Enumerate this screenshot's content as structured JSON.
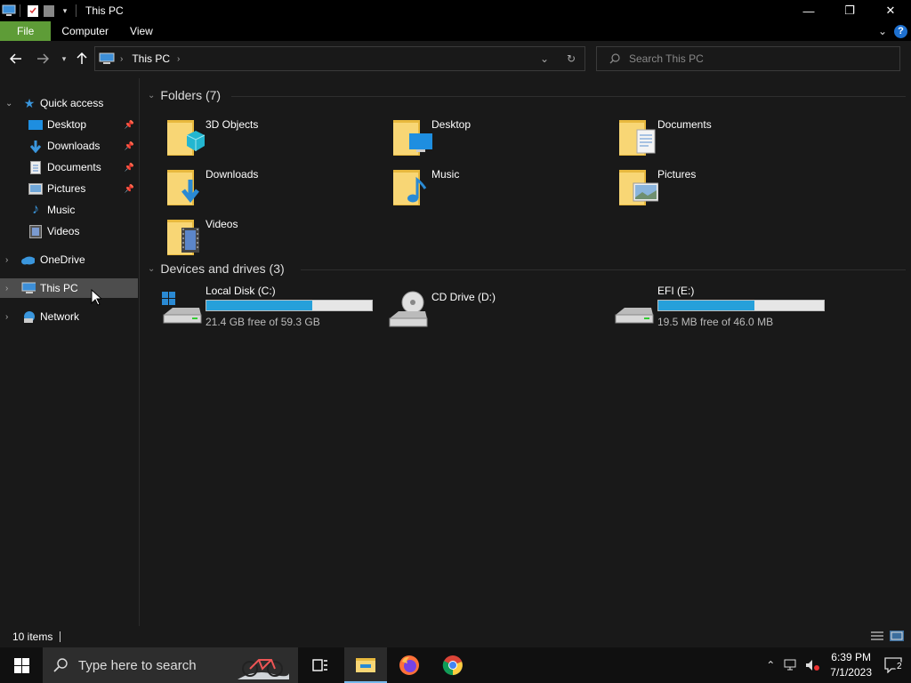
{
  "window": {
    "title": "This PC"
  },
  "ribbon": {
    "tabs": [
      "File",
      "Computer",
      "View"
    ]
  },
  "address": {
    "crumb": "This PC"
  },
  "search": {
    "placeholder": "Search This PC"
  },
  "sidebar": {
    "quick_access": "Quick access",
    "items": [
      {
        "label": "Desktop",
        "pinned": true
      },
      {
        "label": "Downloads",
        "pinned": true
      },
      {
        "label": "Documents",
        "pinned": true
      },
      {
        "label": "Pictures",
        "pinned": true
      },
      {
        "label": "Music",
        "pinned": false
      },
      {
        "label": "Videos",
        "pinned": false
      }
    ],
    "onedrive": "OneDrive",
    "thispc": "This PC",
    "network": "Network"
  },
  "content": {
    "folders_header": "Folders (7)",
    "folders": [
      "3D Objects",
      "Desktop",
      "Documents",
      "Downloads",
      "Music",
      "Pictures",
      "Videos"
    ],
    "drives_header": "Devices and drives (3)",
    "drives": [
      {
        "name": "Local Disk (C:)",
        "free": "21.4 GB free of 59.3 GB",
        "used_fraction": 0.64,
        "has_bar": true
      },
      {
        "name": "CD Drive (D:)",
        "free": "",
        "used_fraction": 0,
        "has_bar": false
      },
      {
        "name": "EFI (E:)",
        "free": "19.5 MB free of 46.0 MB",
        "used_fraction": 0.58,
        "has_bar": true
      }
    ]
  },
  "status": {
    "count": "10 items"
  },
  "taskbar": {
    "search_placeholder": "Type here to search",
    "time": "6:39 PM",
    "date": "7/1/2023",
    "notifications": "2"
  },
  "colors": {
    "file_tab": "#5e9c37",
    "drive_fill": "#26a0da",
    "selected": "#4d4d4d",
    "folder": "#f8d675"
  }
}
